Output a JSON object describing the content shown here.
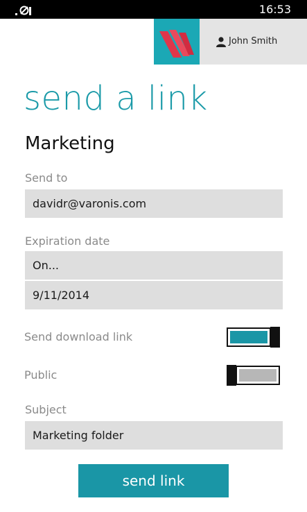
{
  "status_bar": {
    "time": "16:53"
  },
  "header": {
    "user_name": "John Smith"
  },
  "page": {
    "title": "send a link",
    "folder_name": "Marketing"
  },
  "form": {
    "send_to": {
      "label": "Send to",
      "value": "davidr@varonis.com"
    },
    "expiration": {
      "label": "Expiration date",
      "mode": "On...",
      "date": "9/11/2014"
    },
    "send_download_link": {
      "label": "Send download link",
      "on": true
    },
    "public": {
      "label": "Public",
      "on": false
    },
    "subject": {
      "label": "Subject",
      "value": "Marketing folder"
    }
  },
  "actions": {
    "send_label": "send link"
  },
  "colors": {
    "accent": "#1a96a6",
    "field_bg": "#dedede",
    "label": "#8a8a8a"
  }
}
